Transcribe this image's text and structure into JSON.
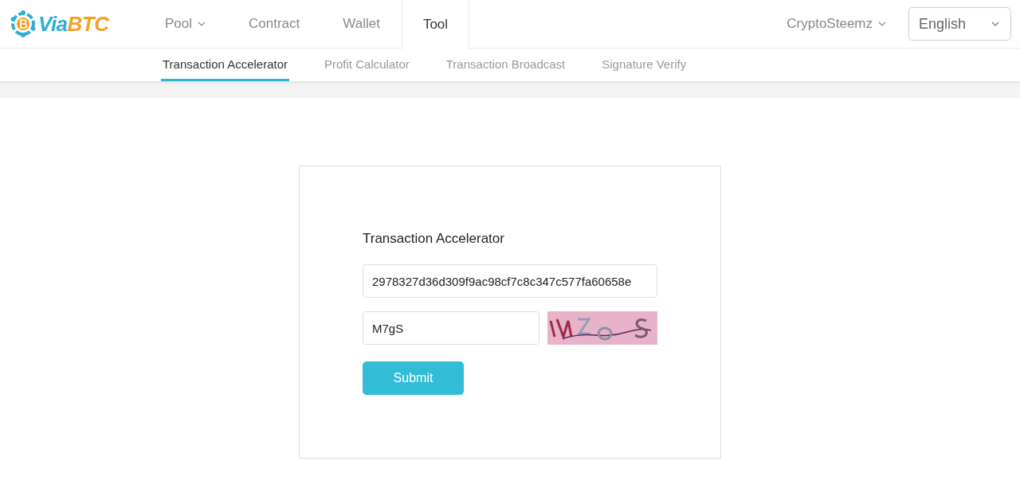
{
  "header": {
    "logo": {
      "parts": [
        {
          "text": "Via",
          "color": "#2eaed6"
        },
        {
          "text": "BTC",
          "color": "#f4a025"
        }
      ]
    },
    "nav": [
      {
        "label": "Pool",
        "dropdown": true,
        "selected": false
      },
      {
        "label": "Contract",
        "dropdown": false,
        "selected": false
      },
      {
        "label": "Wallet",
        "dropdown": false,
        "selected": false
      },
      {
        "label": "Tool",
        "dropdown": false,
        "selected": true
      }
    ],
    "account": {
      "label": "CryptoSteemz"
    },
    "language_select": {
      "value": "English"
    }
  },
  "subnav": [
    {
      "label": "Transaction Accelerator",
      "selected": true
    },
    {
      "label": "Profit Calculator",
      "selected": false
    },
    {
      "label": "Transaction Broadcast",
      "selected": false
    },
    {
      "label": "Signature Verify",
      "selected": false
    }
  ],
  "form": {
    "title": "Transaction Accelerator",
    "txid_field": {
      "value": "2978327d36d309f9ac98cf7c8c347c577fa60658e"
    },
    "captcha_field": {
      "value": "M7gS"
    },
    "submit_button": {
      "label": "Submit"
    }
  }
}
